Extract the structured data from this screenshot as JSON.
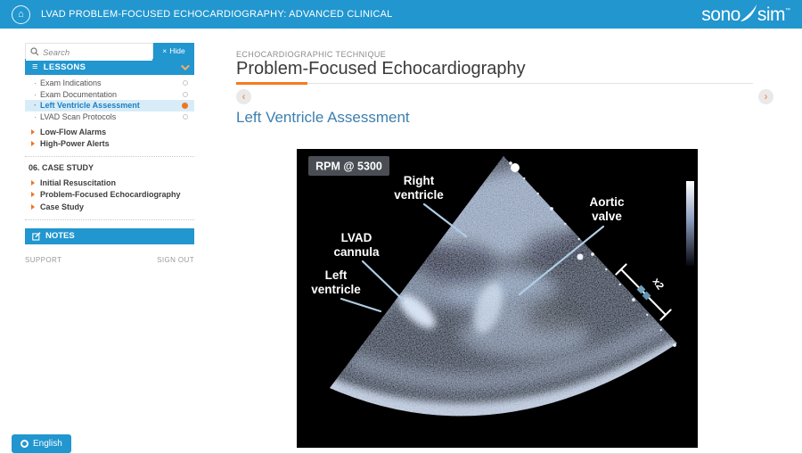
{
  "colors": {
    "primary_blue": "#2196cf",
    "accent_orange": "#ee7623",
    "progress_orange": "#f47b20",
    "selected_row_bg": "#d8ecf8",
    "selected_row_text": "#1b7fc2",
    "subtitle_blue": "#3d7fae",
    "callout_line": "#aecde4"
  },
  "top_bar": {
    "home_icon": "⌂",
    "title": "LVAD PROBLEM-FOCUSED ECHOCARDIOGRAPHY: ADVANCED CLINICAL",
    "logo_prefix": "sono",
    "logo_suffix": "sim",
    "logo_tm": "™"
  },
  "sidebar": {
    "search_placeholder": "Search",
    "hide_close": "×",
    "hide_label": "Hide",
    "lessons_header": "LESSONS",
    "bullet": "·",
    "lessons": [
      {
        "label": "Exam Indications",
        "state": "incomplete"
      },
      {
        "label": "Exam Documentation",
        "state": "incomplete"
      },
      {
        "label": "Left Ventricle Assessment",
        "state": "current"
      },
      {
        "label": "LVAD Scan Protocols",
        "state": "incomplete"
      }
    ],
    "modules": [
      {
        "label": "Low-Flow Alarms"
      },
      {
        "label": "High-Power Alerts"
      }
    ],
    "case_study": {
      "header": "06. CASE STUDY",
      "items": [
        {
          "label": "Initial Resuscitation"
        },
        {
          "label": "Problem-Focused Echocardiography"
        },
        {
          "label": "Case Study"
        }
      ]
    },
    "notes_label": "NOTES",
    "support_label": "SUPPORT",
    "sign_out_label": "SIGN OUT"
  },
  "main": {
    "eyebrow": "ECHOCARDIOGRAPHIC TECHNIQUE",
    "title": "Problem-Focused Echocardiography",
    "subtitle": "Left Ventricle Assessment"
  },
  "ultrasound": {
    "rpm_label": "RPM @ 5300",
    "labels": {
      "right_ventricle": {
        "lines": [
          "Right",
          "ventricle"
        ]
      },
      "aortic_valve": {
        "lines": [
          "Aortic",
          "valve"
        ]
      },
      "lvad_cannula": {
        "lines": [
          "LVAD",
          "cannula"
        ]
      },
      "left_ventricle": {
        "lines": [
          "Left",
          "ventricle"
        ]
      }
    },
    "caliper_label": "x2"
  },
  "language_button": {
    "label": "English"
  }
}
